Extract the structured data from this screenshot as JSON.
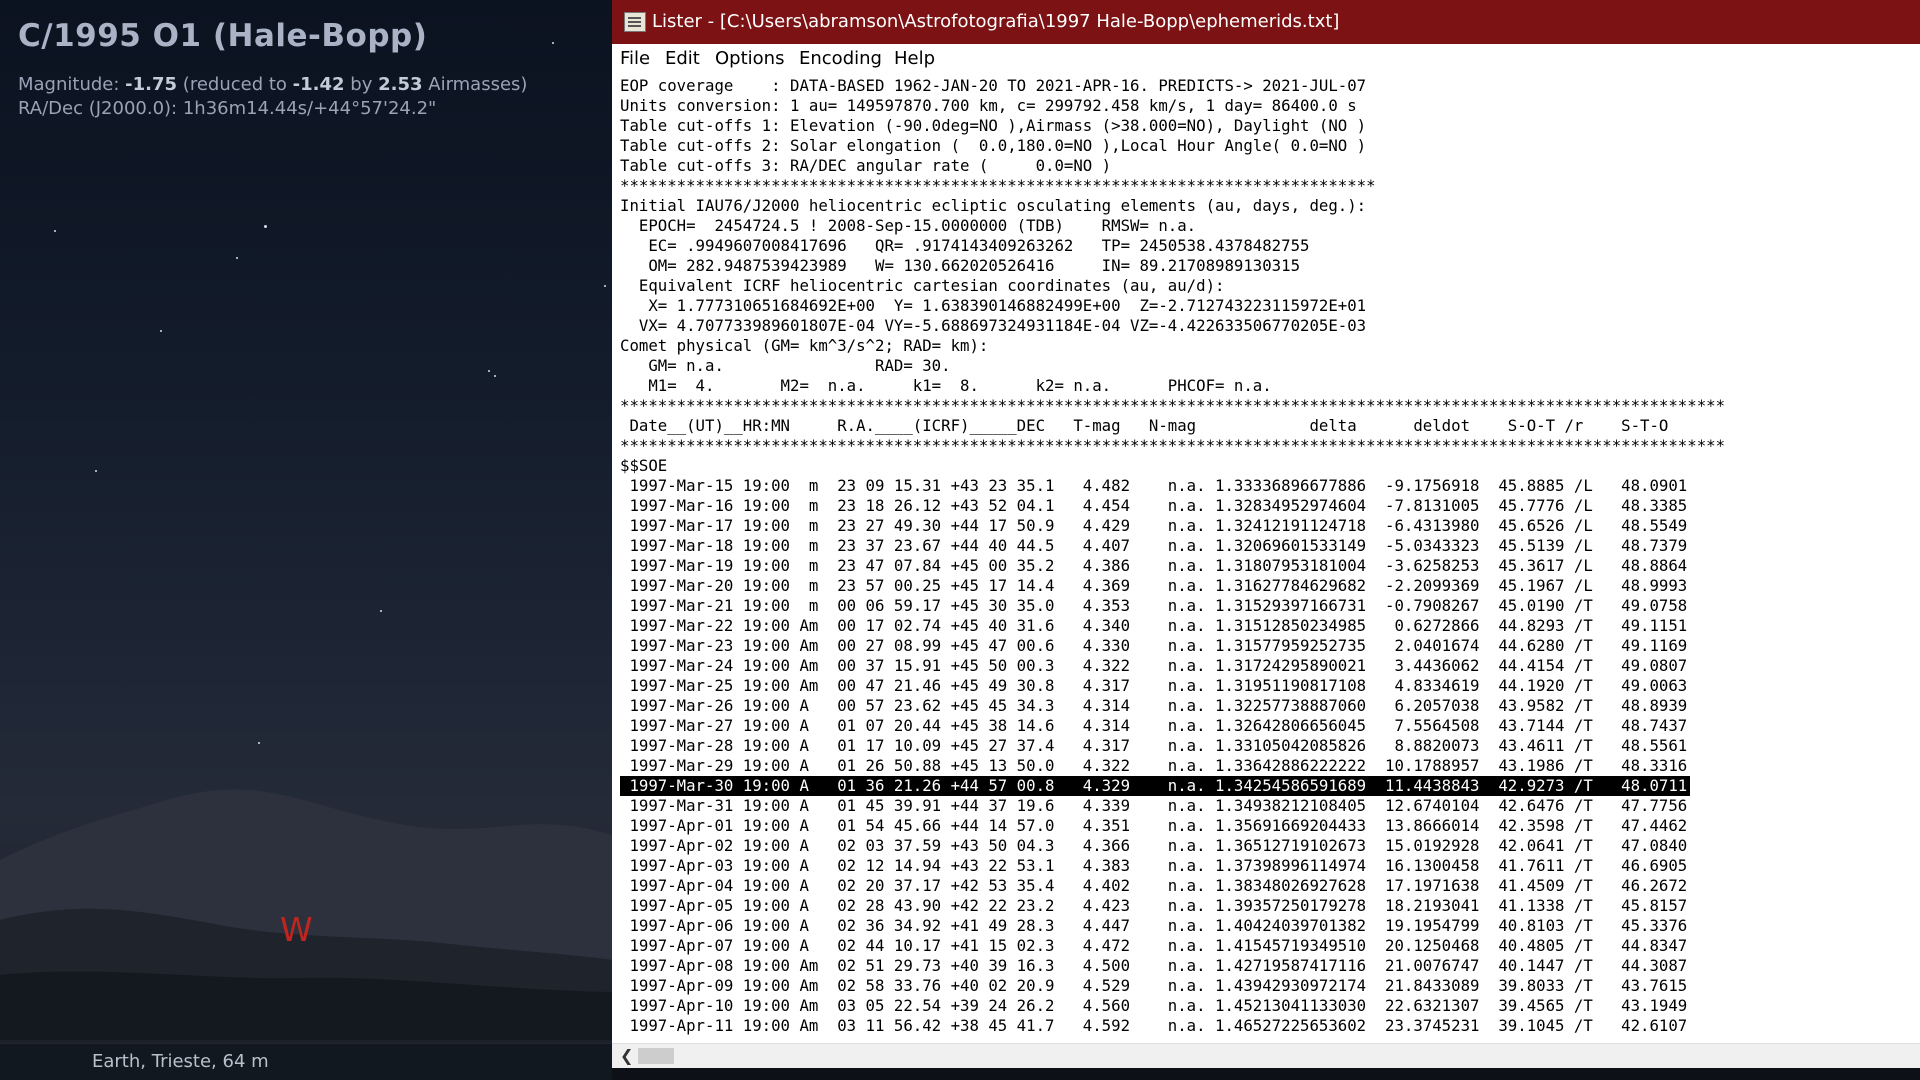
{
  "sky": {
    "object_name": "C/1995 O1 (Hale-Bopp)",
    "magnitude_label": "Magnitude:",
    "magnitude_value": "-1.75",
    "magnitude_reduced_text": "(reduced to",
    "magnitude_reduced_value": "-1.42",
    "magnitude_by": "by",
    "airmass_value": "2.53",
    "airmass_label": "Airmasses)",
    "radec": "RA/Dec (J2000.0):  1h36m14.44s/+44°57'24.2\"",
    "compass_label": "W",
    "location": "Earth, Trieste, 64 m"
  },
  "window": {
    "title": "Lister - [C:\\Users\\abramson\\Astrofotografia\\1997 Hale-Bopp\\ephemerids.txt]",
    "menu": [
      "File",
      "Edit",
      "Options",
      "Encoding",
      "Help"
    ],
    "colors": {
      "titlebar": "#7c1214",
      "selection": "#000000"
    }
  },
  "file_lines": [
    "EOP coverage    : DATA-BASED 1962-JAN-20 TO 2021-APR-16. PREDICTS-> 2021-JUL-07",
    "Units conversion: 1 au= 149597870.700 km, c= 299792.458 km/s, 1 day= 86400.0 s",
    "Table cut-offs 1: Elevation (-90.0deg=NO ),Airmass (>38.000=NO), Daylight (NO )",
    "Table cut-offs 2: Solar elongation (  0.0,180.0=NO ),Local Hour Angle( 0.0=NO )",
    "Table cut-offs 3: RA/DEC angular rate (     0.0=NO )",
    "********************************************************************************",
    "Initial IAU76/J2000 heliocentric ecliptic osculating elements (au, days, deg.):",
    "  EPOCH=  2454724.5 ! 2008-Sep-15.0000000 (TDB)    RMSW= n.a.",
    "   EC= .9949607008417696   QR= .9174143409263262   TP= 2450538.4378482755",
    "   OM= 282.9487539423989   W= 130.662020526416     IN= 89.21708989130315",
    "  Equivalent ICRF heliocentric cartesian coordinates (au, au/d):",
    "   X= 1.777310651684692E+00  Y= 1.638390146882499E+00  Z=-2.712743223115972E+01",
    "  VX= 4.707733989601807E-04 VY=-5.688697324931184E-04 VZ=-4.422633506770205E-03",
    "Comet physical (GM= km^3/s^2; RAD= km):",
    "   GM= n.a.                RAD= 30.",
    "   M1=  4.       M2=  n.a.     k1=  8.      k2= n.a.      PHCOF= n.a.",
    "*********************************************************************************************************************",
    " Date__(UT)__HR:MN     R.A.____(ICRF)_____DEC   T-mag   N-mag            delta      deldot    S-O-T /r    S-T-O",
    "*********************************************************************************************************************",
    "$$SOE",
    " 1997-Mar-15 19:00  m  23 09 15.31 +43 23 35.1   4.482    n.a. 1.33336896677886  -9.1756918  45.8885 /L   48.0901",
    " 1997-Mar-16 19:00  m  23 18 26.12 +43 52 04.1   4.454    n.a. 1.32834952974604  -7.8131005  45.7776 /L   48.3385",
    " 1997-Mar-17 19:00  m  23 27 49.30 +44 17 50.9   4.429    n.a. 1.32412191124718  -6.4313980  45.6526 /L   48.5549",
    " 1997-Mar-18 19:00  m  23 37 23.67 +44 40 44.5   4.407    n.a. 1.32069601533149  -5.0343323  45.5139 /L   48.7379",
    " 1997-Mar-19 19:00  m  23 47 07.84 +45 00 35.2   4.386    n.a. 1.31807953181004  -3.6258253  45.3617 /L   48.8864",
    " 1997-Mar-20 19:00  m  23 57 00.25 +45 17 14.4   4.369    n.a. 1.31627784629682  -2.2099369  45.1967 /L   48.9993",
    " 1997-Mar-21 19:00  m  00 06 59.17 +45 30 35.0   4.353    n.a. 1.31529397166731  -0.7908267  45.0190 /T   49.0758",
    " 1997-Mar-22 19:00 Am  00 17 02.74 +45 40 31.6   4.340    n.a. 1.31512850234985   0.6272866  44.8293 /T   49.1151",
    " 1997-Mar-23 19:00 Am  00 27 08.99 +45 47 00.6   4.330    n.a. 1.31577959252735   2.0401674  44.6280 /T   49.1169",
    " 1997-Mar-24 19:00 Am  00 37 15.91 +45 50 00.3   4.322    n.a. 1.31724295890021   3.4436062  44.4154 /T   49.0807",
    " 1997-Mar-25 19:00 Am  00 47 21.46 +45 49 30.8   4.317    n.a. 1.31951190817108   4.8334619  44.1920 /T   49.0063",
    " 1997-Mar-26 19:00 A   00 57 23.62 +45 45 34.3   4.314    n.a. 1.32257738887060   6.2057038  43.9582 /T   48.8939",
    " 1997-Mar-27 19:00 A   01 07 20.44 +45 38 14.6   4.314    n.a. 1.32642806656045   7.5564508  43.7144 /T   48.7437",
    " 1997-Mar-28 19:00 A   01 17 10.09 +45 27 37.4   4.317    n.a. 1.33105042085826   8.8820073  43.4611 /T   48.5561",
    " 1997-Mar-29 19:00 A   01 26 50.88 +45 13 50.0   4.322    n.a. 1.33642886222222  10.1788957  43.1986 /T   48.3316",
    " 1997-Mar-30 19:00 A   01 36 21.26 +44 57 00.8   4.329    n.a. 1.34254586591689  11.4438843  42.9273 /T   48.0711",
    " 1997-Mar-31 19:00 A   01 45 39.91 +44 37 19.6   4.339    n.a. 1.34938212108405  12.6740104  42.6476 /T   47.7756",
    " 1997-Apr-01 19:00 A   01 54 45.66 +44 14 57.0   4.351    n.a. 1.35691669204433  13.8666014  42.3598 /T   47.4462",
    " 1997-Apr-02 19:00 A   02 03 37.59 +43 50 04.3   4.366    n.a. 1.36512719102673  15.0192928  42.0641 /T   47.0840",
    " 1997-Apr-03 19:00 A   02 12 14.94 +43 22 53.1   4.383    n.a. 1.37398996114974  16.1300458  41.7611 /T   46.6905",
    " 1997-Apr-04 19:00 A   02 20 37.17 +42 53 35.4   4.402    n.a. 1.38348026927628  17.1971638  41.4509 /T   46.2672",
    " 1997-Apr-05 19:00 A   02 28 43.90 +42 22 23.2   4.423    n.a. 1.39357250179278  18.2193041  41.1338 /T   45.8157",
    " 1997-Apr-06 19:00 A   02 36 34.92 +41 49 28.3   4.447    n.a. 1.40424039701382  19.1954799  40.8103 /T   45.3376",
    " 1997-Apr-07 19:00 A   02 44 10.17 +41 15 02.3   4.472    n.a. 1.41545719349510  20.1250468  40.4805 /T   44.8347",
    " 1997-Apr-08 19:00 Am  02 51 29.73 +40 39 16.3   4.500    n.a. 1.42719587417116  21.0076747  40.1447 /T   44.3087",
    " 1997-Apr-09 19:00 Am  02 58 33.76 +40 02 20.9   4.529    n.a. 1.43942930972174  21.8433089  39.8033 /T   43.7615",
    " 1997-Apr-10 19:00 Am  03 05 22.54 +39 24 26.2   4.560    n.a. 1.45213041133030  22.6321307  39.4565 /T   43.1949",
    " 1997-Apr-11 19:00 Am  03 11 56.42 +38 45 41.7   4.592    n.a. 1.46527225653602  23.3745231  39.1045 /T   42.6107"
  ],
  "selected_line": 35
}
